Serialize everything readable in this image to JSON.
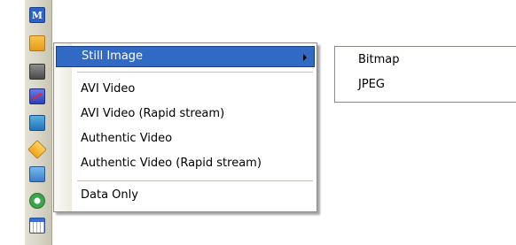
{
  "toolbar": {
    "icons": [
      "m-logo-icon",
      "folder-icon",
      "printer-icon",
      "video-disabled-icon",
      "photo-icon",
      "tag-icon",
      "edit-icon",
      "refresh-icon",
      "grid-icon"
    ],
    "m_label": "M"
  },
  "context_menu": {
    "items": [
      {
        "label": "Still Image",
        "has_submenu": true,
        "highlighted": true
      },
      {
        "label": "AVI Video"
      },
      {
        "label": "AVI Video (Rapid stream)"
      },
      {
        "label": "Authentic Video"
      },
      {
        "label": "Authentic Video (Rapid stream)"
      },
      {
        "label": "Data Only"
      }
    ]
  },
  "submenu": {
    "items": [
      {
        "label": "Bitmap"
      },
      {
        "label": "JPEG"
      }
    ]
  },
  "colors": {
    "highlight": "#316ac5",
    "toolbar": "#d6d3c4"
  }
}
